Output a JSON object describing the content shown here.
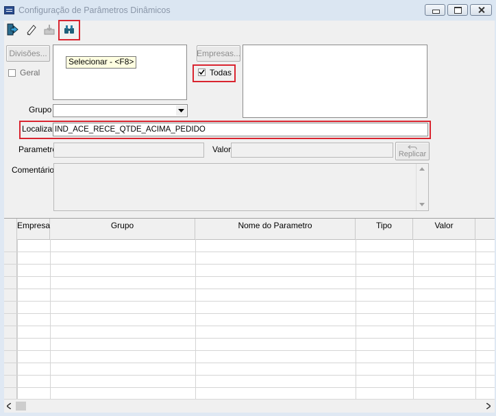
{
  "window": {
    "title": "Configuração de Parâmetros Dinâmicos"
  },
  "toolbar": {
    "exit_icon": "exit-door-icon",
    "edit_icon": "eraser-icon",
    "import_icon": "import-tray-icon",
    "find_icon": "binoculars-icon"
  },
  "tooltip": {
    "text": "Selecionar - <F8>"
  },
  "left_panel": {
    "divisoes_label": "Divisões...",
    "geral_label": "Geral",
    "grupo_label": "Grupo",
    "grupo_value": ""
  },
  "right_panel": {
    "empresas_label": "Empresas...",
    "todas_label": "Todas",
    "todas_checked": true
  },
  "search": {
    "label": "Localizar",
    "value": "IND_ACE_RECE_QTDE_ACIMA_PEDIDO"
  },
  "param": {
    "parametro_label": "Parametro",
    "valor_label": "Valor",
    "replicar_label": "Replicar",
    "comentarios_label": "Comentários"
  },
  "grid": {
    "columns": [
      "Empresa",
      "Grupo",
      "Nome do Parametro",
      "Tipo",
      "Valor"
    ],
    "rows": []
  },
  "colors": {
    "highlight": "#d9232e",
    "tooltip_bg": "#ffffe1",
    "face": "#f0f0f0"
  }
}
